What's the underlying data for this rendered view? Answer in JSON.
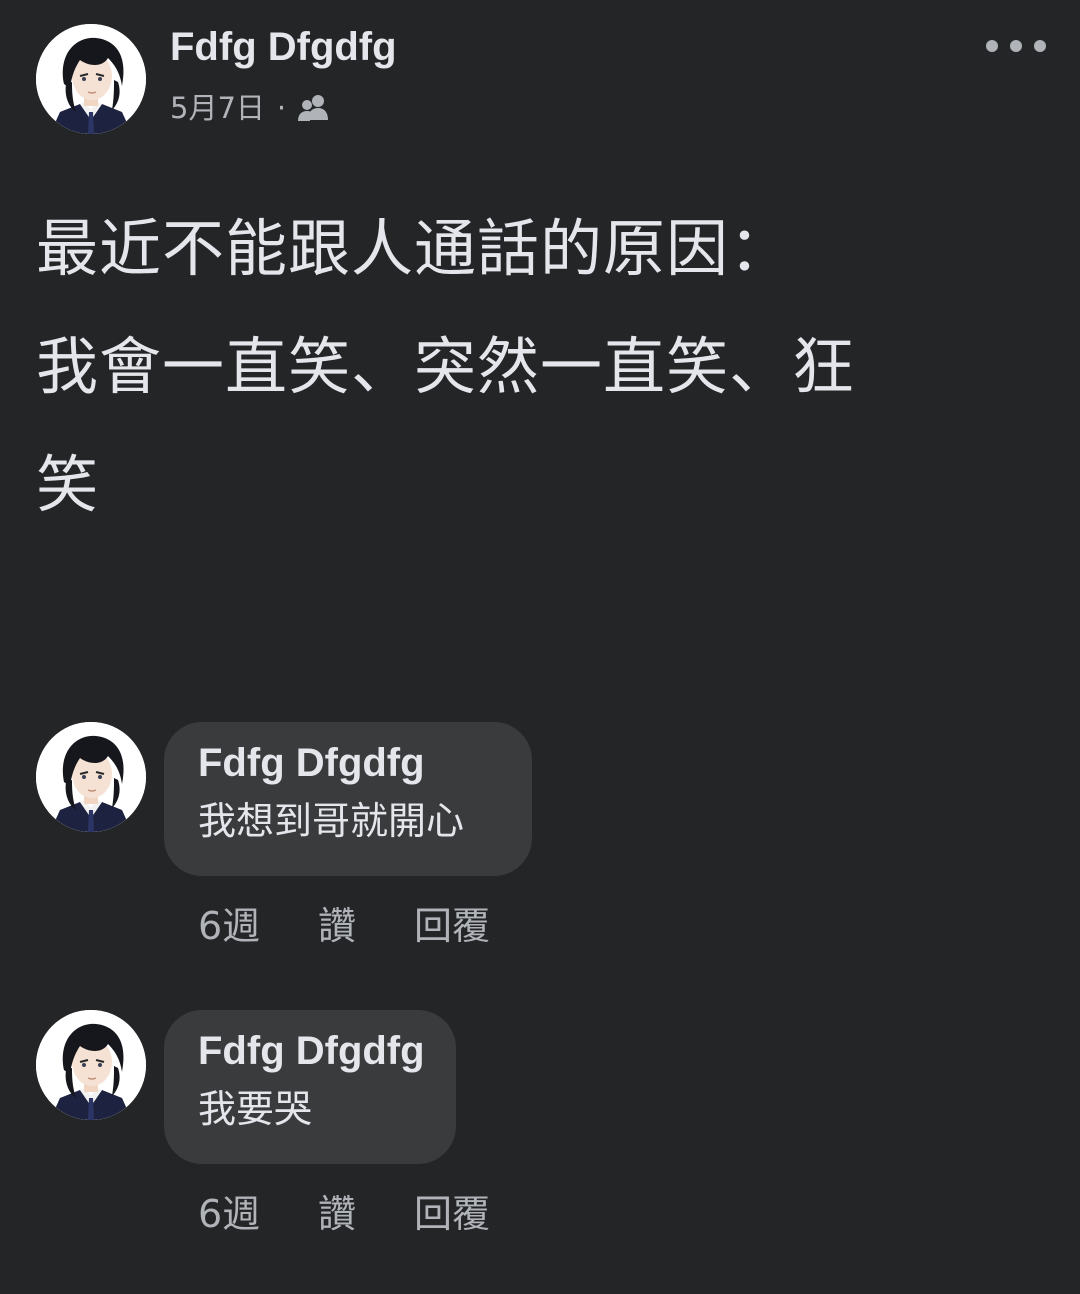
{
  "post": {
    "author": "Fdfg Dfgdfg",
    "date": "5月7日",
    "separator": "·",
    "audience_icon": "friends-icon",
    "more_icon": "more-horizontal-icon",
    "body": "最近不能跟人通話的原因：\n我會一直笑、突然一直笑、狂\n笑"
  },
  "comments": [
    {
      "author": "Fdfg Dfgdfg",
      "text": "我想到哥就開心",
      "time": "6週",
      "like_label": "讚",
      "reply_label": "回覆"
    },
    {
      "author": "Fdfg Dfgdfg",
      "text": "我要哭",
      "time": "6週",
      "like_label": "讚",
      "reply_label": "回覆"
    }
  ],
  "colors": {
    "background": "#242527",
    "bubble": "#3a3b3c",
    "primary_text": "#e4e6eb",
    "secondary_text": "#b0b3b8"
  }
}
